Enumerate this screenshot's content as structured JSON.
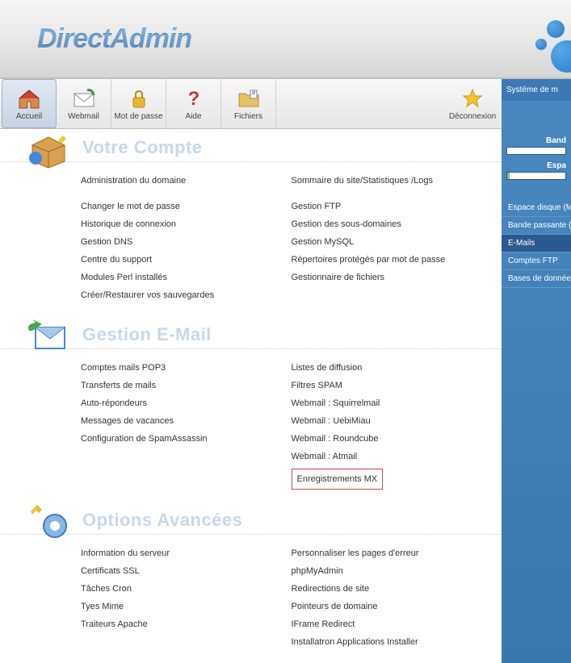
{
  "brand": "DirectAdmin",
  "toolbar": [
    {
      "id": "home",
      "label": "Accueil"
    },
    {
      "id": "webmail",
      "label": "Webmail"
    },
    {
      "id": "password",
      "label": "Mot de passe"
    },
    {
      "id": "help",
      "label": "Aide"
    },
    {
      "id": "files",
      "label": "Fichiers"
    },
    {
      "id": "logout",
      "label": "Déconnexion"
    }
  ],
  "sections": {
    "account": {
      "title": "Votre Compte",
      "left": [
        "Administration du domaine",
        "Changer le mot de passe",
        "Historique de connexion",
        "Gestion DNS",
        "Centre du support",
        "Modules Perl installés",
        "Créer/Restaurer vos sauvegardes"
      ],
      "right": [
        "Sommaire du site/Statistiques /Logs",
        "Gestion FTP",
        "Gestion des sous-domaines",
        "Gestion MySQL",
        "Répertoires protégés par mot de passe",
        "Gestionnaire de fichiers"
      ]
    },
    "email": {
      "title": "Gestion E-Mail",
      "left": [
        "Comptes mails POP3",
        "Transferts de mails",
        "Auto-répondeurs",
        "Messages de vacances",
        "Configuration de SpamAssassin"
      ],
      "right": [
        "Listes de diffusion",
        "Filtres SPAM",
        "Webmail : Squirrelmail",
        "Webmail : UebiMiau",
        "Webmail : Roundcube",
        "Webmail : Atmail",
        "Enregistrements MX"
      ]
    },
    "advanced": {
      "title": "Options Avancées",
      "left": [
        "Information du serveur",
        "Certificats SSL",
        "Tâches Cron",
        "Tyes Mime",
        "Traiteurs Apache"
      ],
      "right": [
        "Personnaliser les pages d'erreur",
        "phpMyAdmin",
        "Redirections de site",
        "Pointeurs de domaine",
        "IFrame Redirect",
        "Installatron Applications Installer"
      ]
    }
  },
  "sidebar": {
    "system_label": "Système de m",
    "stats": [
      {
        "label": "Band",
        "pct": 0
      },
      {
        "label": "Espa",
        "pct": 4
      }
    ],
    "menu": [
      {
        "label": "Espace disque (M",
        "active": false
      },
      {
        "label": "Bande passante (",
        "active": false
      },
      {
        "label": "E-Mails",
        "active": true
      },
      {
        "label": "Comptes FTP",
        "active": false
      },
      {
        "label": "Bases de donnée",
        "active": false
      }
    ]
  }
}
